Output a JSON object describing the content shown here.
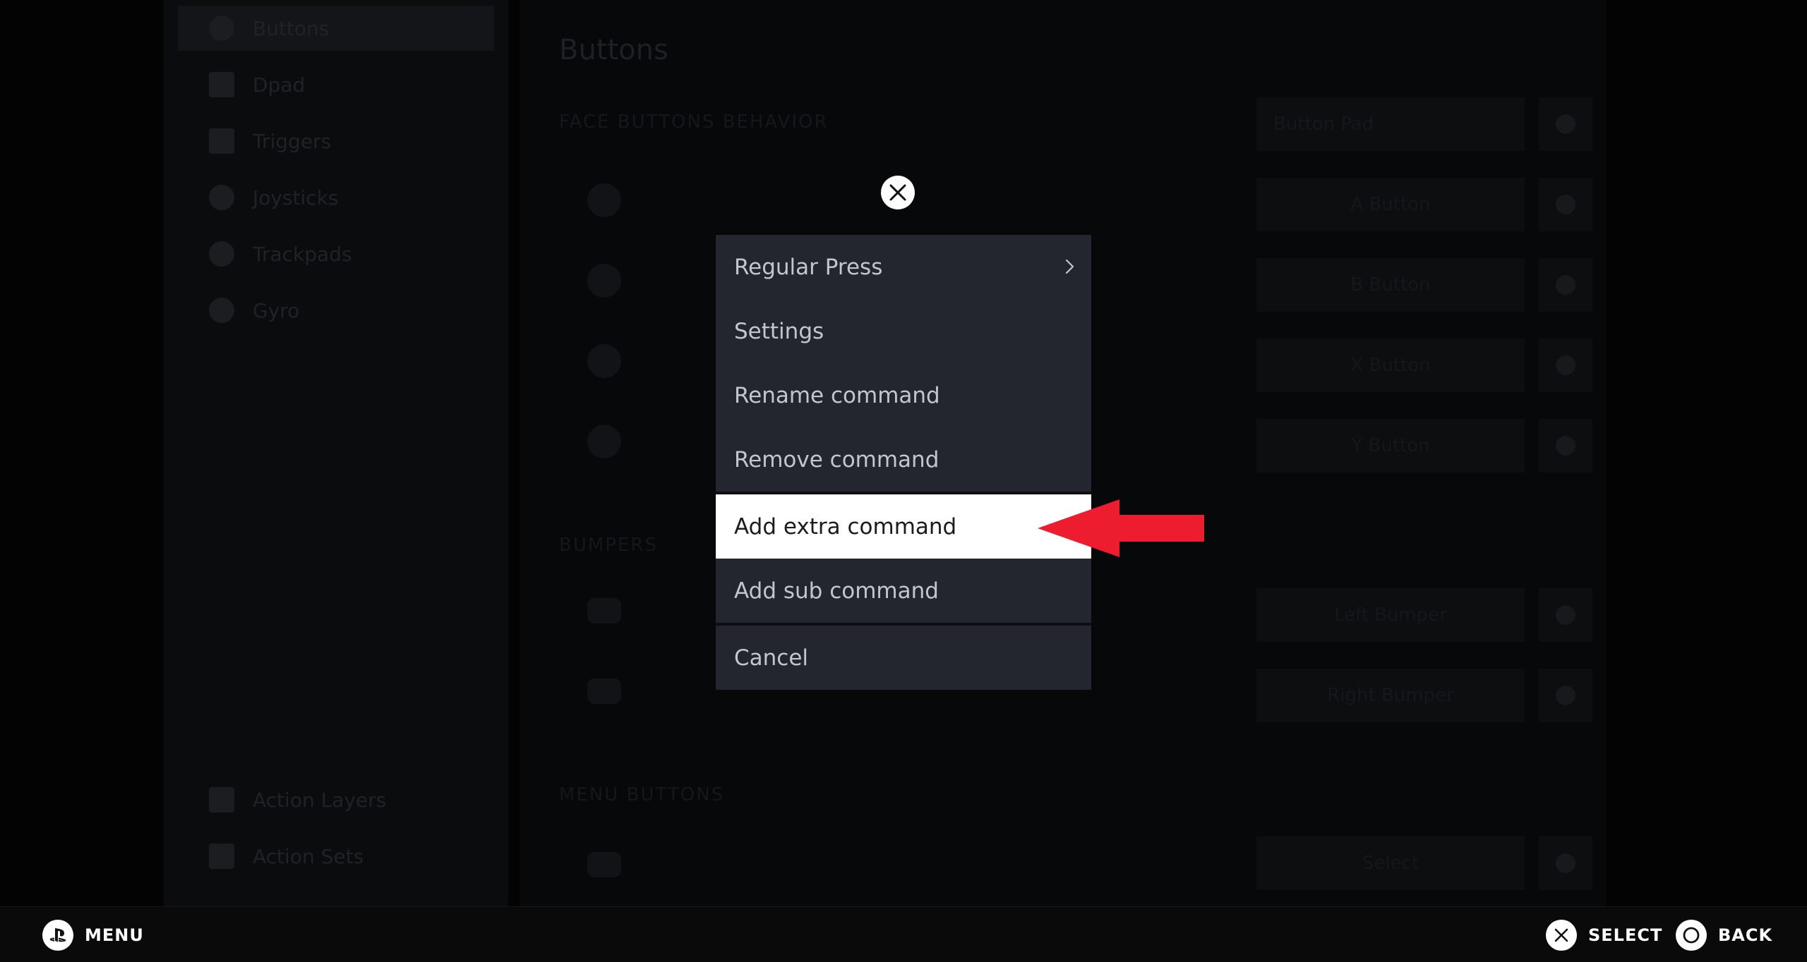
{
  "background": {
    "sidebar": [
      "Buttons",
      "Dpad",
      "Triggers",
      "Joysticks",
      "Trackpads",
      "Gyro"
    ],
    "sidebar_bottom": [
      "Action Layers",
      "Action Sets"
    ],
    "title": "Buttons",
    "section_face": "FACE BUTTONS BEHAVIOR",
    "section_bumpers": "BUMPERS",
    "section_menu": "MENU BUTTONS",
    "behavior_value": "Button Pad",
    "buttons": [
      "A Button",
      "B Button",
      "X Button",
      "Y Button"
    ],
    "bumpers": [
      "Left Bumper",
      "Right Bumper"
    ],
    "menu_buttons": [
      "Select"
    ]
  },
  "context_menu": {
    "items": [
      {
        "label": "Regular Press",
        "has_submenu": true
      },
      {
        "label": "Settings"
      },
      {
        "label": "Rename command"
      },
      {
        "label": "Remove command"
      },
      {
        "label": "Add extra command",
        "focused": true
      },
      {
        "label": "Add sub command"
      }
    ],
    "cancel_label": "Cancel"
  },
  "annotation": {
    "arrow_color": "#ed1c2e"
  },
  "footer": {
    "menu_label": "MENU",
    "select_label": "SELECT",
    "back_label": "BACK"
  }
}
